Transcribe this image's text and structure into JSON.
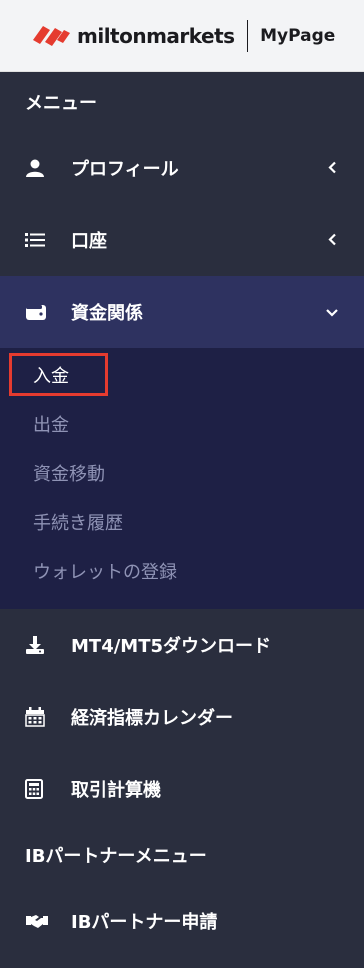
{
  "header": {
    "brand": "miltonmarkets",
    "sub": "MyPage",
    "brand_color": "#e53b2f"
  },
  "menu": {
    "title": "メニュー",
    "items": [
      {
        "label": "プロフィール",
        "icon": "user-icon",
        "chevron": "chevron-left-icon"
      },
      {
        "label": "口座",
        "icon": "list-icon",
        "chevron": "chevron-left-icon"
      },
      {
        "label": "資金関係",
        "icon": "wallet-icon",
        "chevron": "chevron-down-icon"
      },
      {
        "label": "MT4/MT5ダウンロード",
        "icon": "download-icon"
      },
      {
        "label": "経済指標カレンダー",
        "icon": "calendar-icon"
      },
      {
        "label": "取引計算機",
        "icon": "calculator-icon"
      }
    ],
    "submenu": [
      {
        "label": "入金"
      },
      {
        "label": "出金"
      },
      {
        "label": "資金移動"
      },
      {
        "label": "手続き履歴"
      },
      {
        "label": "ウォレットの登録"
      }
    ]
  },
  "ib_menu": {
    "title": "IBパートナーメニュー",
    "items": [
      {
        "label": "IBパートナー申請",
        "icon": "handshake-icon"
      }
    ]
  }
}
